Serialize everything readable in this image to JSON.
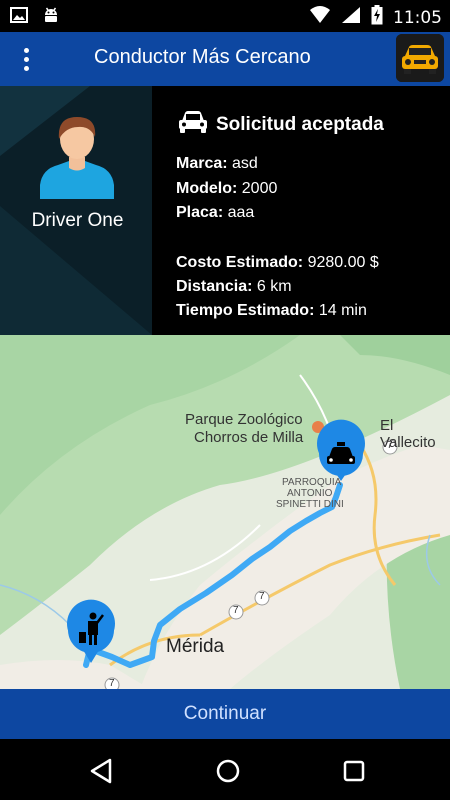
{
  "status_bar": {
    "time": "11:05"
  },
  "app_bar": {
    "title": "Conductor Más Cercano"
  },
  "driver": {
    "name": "Driver One"
  },
  "request": {
    "status": "Solicitud aceptada",
    "marca_label": "Marca:",
    "marca_value": "asd",
    "modelo_label": "Modelo:",
    "modelo_value": "2000",
    "placa_label": "Placa:",
    "placa_value": "aaa",
    "costo_label": "Costo Estimado:",
    "costo_value": "9280.00 $",
    "distancia_label": "Distancia:",
    "distancia_value": "6 km",
    "tiempo_label": "Tiempo Estimado:",
    "tiempo_value": "14 min"
  },
  "map": {
    "labels": {
      "zoo_line1": "Parque Zoológico",
      "zoo_line2": "Chorros de Milla",
      "vallecito": "El Vallecito",
      "parroquia_line1": "PARROQUIA",
      "parroquia_line2": "ANTONIO",
      "parroquia_line3": "SPINETTI DINI",
      "city": "Mérida",
      "road_7a": "7",
      "road_7b": "7",
      "road_7c": "7",
      "road_7d": "7"
    },
    "route_color": "#3fa9f5"
  },
  "continue_button": {
    "label": "Continuar"
  },
  "colors": {
    "primary": "#0d47a1",
    "route": "#3fa9f5",
    "marker": "#1e88e5"
  }
}
